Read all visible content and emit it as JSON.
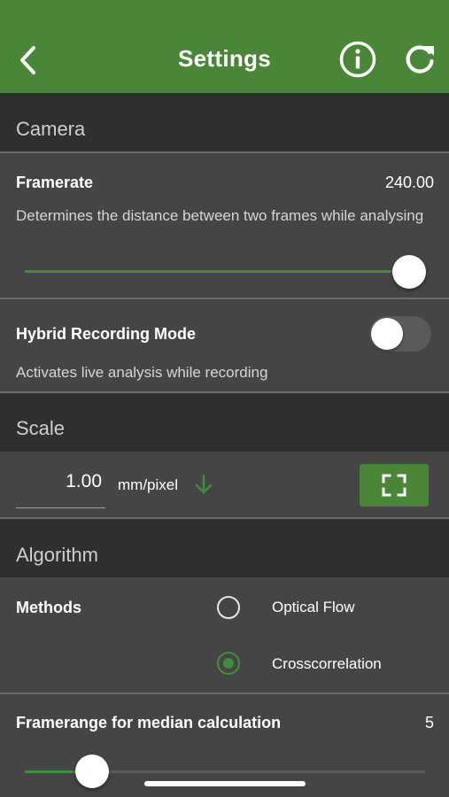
{
  "header": {
    "title": "Settings",
    "back_icon": "chevron-left-icon",
    "info_icon": "info-circle-icon",
    "refresh_icon": "refresh-icon"
  },
  "camera": {
    "section_title": "Camera",
    "framerate": {
      "label": "Framerate",
      "value": "240.00",
      "description": "Determines the distance between two frames while analysing",
      "slider_level": 1.0
    },
    "hybrid": {
      "label": "Hybrid Recording Mode",
      "description": "Activates live analysis while recording",
      "enabled": false
    }
  },
  "scale": {
    "section_title": "Scale",
    "value": "1.00",
    "unit": "mm/pixel",
    "unit_icon": "arrow-down-icon",
    "scan_icon": "scan-frame-icon"
  },
  "algorithm": {
    "section_title": "Algorithm",
    "methods_label": "Methods",
    "options": [
      {
        "label": "Optical Flow",
        "selected": false
      },
      {
        "label": "Crosscorrelation",
        "selected": true
      }
    ],
    "framerange": {
      "label": "Framerange for median calculation",
      "value": "5",
      "slider_level": 0.18
    }
  },
  "colors": {
    "accent_green": "#4a8637",
    "background": "#454545",
    "section_header": "#2f2f2f"
  }
}
